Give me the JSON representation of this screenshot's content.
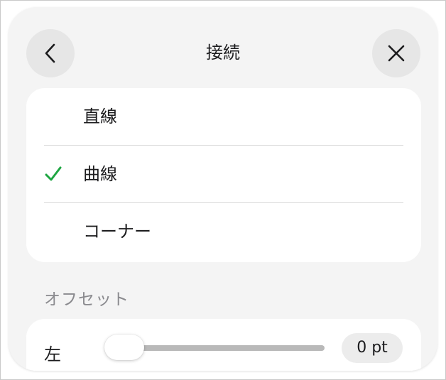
{
  "header": {
    "title": "接続",
    "back_icon": "chevron-left-icon",
    "close_icon": "close-icon"
  },
  "connection_options": {
    "items": [
      {
        "label": "直線",
        "selected": false
      },
      {
        "label": "曲線",
        "selected": true
      },
      {
        "label": "コーナー",
        "selected": false
      }
    ],
    "check_color": "#1fa643"
  },
  "offset": {
    "section_label": "オフセット",
    "left_label": "左",
    "value": "0 pt",
    "slider_fraction": 0
  }
}
